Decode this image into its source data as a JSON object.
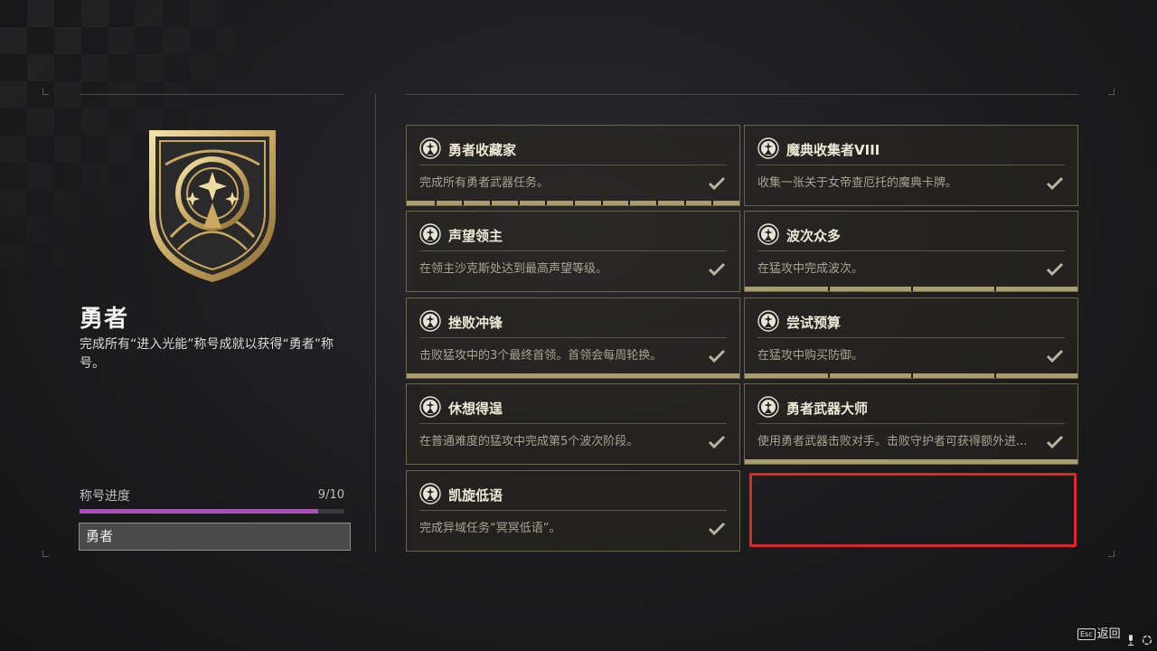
{
  "seal": {
    "title": "勇者",
    "description": "完成所有“进入光能”称号成就以获得“勇者”称号。",
    "progress_label": "称号进度",
    "progress_text": "9/10",
    "progress_fraction": 0.9,
    "title_box_value": "勇者",
    "progress_color": "#b24bc2"
  },
  "triumphs": [
    {
      "name": "勇者收藏家",
      "description": "完成所有勇者武器任务。",
      "icon": "triumph-emblem-icon",
      "completed": true,
      "segments": 12
    },
    {
      "name": "魔典收集者VIII",
      "description": "收集一张关于女帝查厄托的魔典卡牌。",
      "icon": "triumph-emblem-icon",
      "completed": true,
      "segments": 0
    },
    {
      "name": "声望领主",
      "description": "在领主沙克斯处达到最高声望等级。",
      "icon": "triumph-emblem-icon",
      "completed": true,
      "segments": 0
    },
    {
      "name": "波次众多",
      "description": "在猛攻中完成波次。",
      "icon": "triumph-emblem-icon",
      "completed": true,
      "segments": 4
    },
    {
      "name": "挫败冲锋",
      "description": "击败猛攻中的3个最终首领。首领会每周轮换。",
      "icon": "triumph-emblem-icon",
      "completed": true,
      "segments": 1
    },
    {
      "name": "尝试预算",
      "description": "在猛攻中购买防御。",
      "icon": "triumph-emblem-icon",
      "completed": true,
      "segments": 4
    },
    {
      "name": "休想得逞",
      "description": "在普通难度的猛攻中完成第5个波次阶段。",
      "icon": "triumph-emblem-icon",
      "completed": true,
      "segments": 0
    },
    {
      "name": "勇者武器大师",
      "description": "使用勇者武器击败对手。击败守护者可获得额外进...",
      "icon": "triumph-emblem-icon",
      "completed": true,
      "segments": 1
    },
    {
      "name": "凯旋低语",
      "description": "完成异域任务“冥冥低语”。",
      "icon": "triumph-emblem-icon",
      "completed": true,
      "segments": 0
    }
  ],
  "footer": {
    "esc_label": "Esc",
    "back_label": "返回"
  },
  "colors": {
    "card_border": "#6c6548",
    "bar_gold": "#a99d6e",
    "highlight_red": "#e02626"
  }
}
